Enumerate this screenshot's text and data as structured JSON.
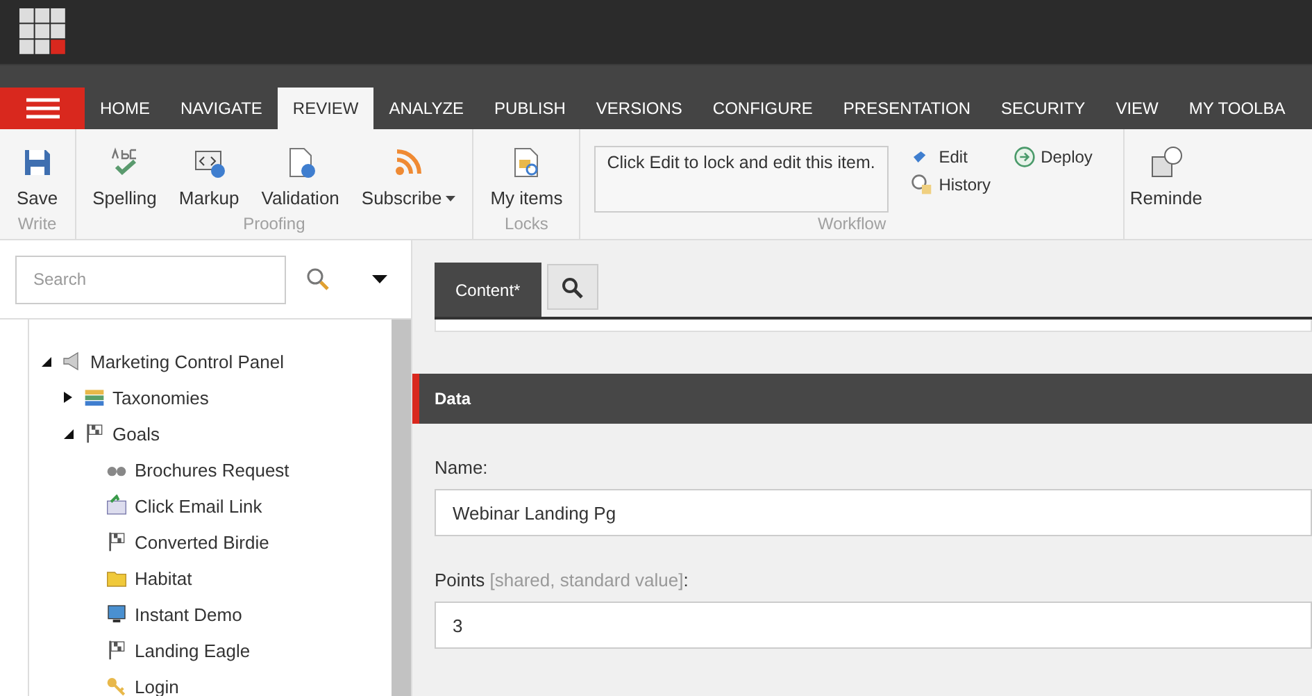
{
  "nav_tabs": [
    {
      "label": "HOME",
      "selected": false
    },
    {
      "label": "NAVIGATE",
      "selected": false
    },
    {
      "label": "REVIEW",
      "selected": true
    },
    {
      "label": "ANALYZE",
      "selected": false
    },
    {
      "label": "PUBLISH",
      "selected": false
    },
    {
      "label": "VERSIONS",
      "selected": false
    },
    {
      "label": "CONFIGURE",
      "selected": false
    },
    {
      "label": "PRESENTATION",
      "selected": false
    },
    {
      "label": "SECURITY",
      "selected": false
    },
    {
      "label": "VIEW",
      "selected": false
    },
    {
      "label": "MY TOOLBA",
      "selected": false
    }
  ],
  "ribbon": {
    "groups": [
      {
        "label": "Write",
        "buttons": [
          {
            "kind": "save",
            "label": "Save"
          }
        ]
      },
      {
        "label": "Proofing",
        "buttons": [
          {
            "kind": "spelling",
            "label": "Spelling"
          },
          {
            "kind": "markup",
            "label": "Markup"
          },
          {
            "kind": "validation",
            "label": "Validation"
          },
          {
            "kind": "subscribe",
            "label": "Subscribe",
            "dropdown": true
          }
        ]
      },
      {
        "label": "Locks",
        "buttons": [
          {
            "kind": "locks",
            "label": "My items"
          }
        ]
      }
    ],
    "workflow": {
      "label": "Workflow",
      "message": "Click Edit to lock and edit this item.",
      "actions": [
        {
          "kind": "edit",
          "label": "Edit"
        },
        {
          "kind": "history",
          "label": "History"
        },
        {
          "kind": "deploy",
          "label": "Deploy"
        }
      ]
    },
    "cut_button": {
      "kind": "reminder",
      "label": "Reminde"
    }
  },
  "search": {
    "placeholder": "Search"
  },
  "tree": [
    {
      "label": "Marketing Control Panel",
      "kind": "megaphone",
      "expanded": true,
      "children": [
        {
          "label": "Taxonomies",
          "kind": "books",
          "expanded": false
        },
        {
          "label": "Goals",
          "kind": "flag",
          "expanded": true,
          "children": [
            {
              "label": "Brochures Request",
              "kind": "binoculars"
            },
            {
              "label": "Click Email Link",
              "kind": "mail"
            },
            {
              "label": "Converted Birdie",
              "kind": "flag"
            },
            {
              "label": "Habitat",
              "kind": "folder"
            },
            {
              "label": "Instant Demo",
              "kind": "monitor"
            },
            {
              "label": "Landing Eagle",
              "kind": "flag"
            },
            {
              "label": "Login",
              "kind": "key"
            }
          ]
        }
      ]
    }
  ],
  "editor_tabs": [
    {
      "label": "Content*",
      "selected": true
    }
  ],
  "section": {
    "title": "Data",
    "fields": [
      {
        "label": "Name:",
        "value": "Webinar Landing Pg"
      },
      {
        "label": "Points",
        "note": "[shared, standard value]",
        "label_end": ":",
        "value": "3"
      }
    ]
  }
}
